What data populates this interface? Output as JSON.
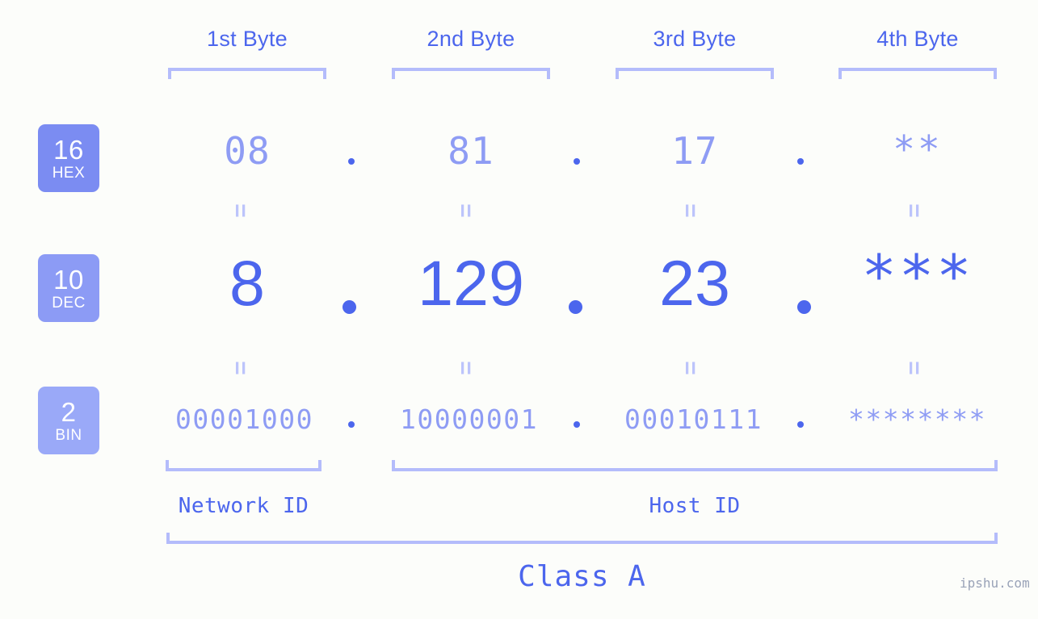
{
  "page": {
    "background_color": "#fcfdfa",
    "accent_color": "#4c66ed",
    "muted_color": "#8e9cf4",
    "bracket_color": "#b4bcfb"
  },
  "byte_headers": [
    {
      "label": "1st Byte"
    },
    {
      "label": "2nd Byte"
    },
    {
      "label": "3rd Byte"
    },
    {
      "label": "4th Byte"
    }
  ],
  "bases": [
    {
      "number": "16",
      "name": "HEX",
      "color": "#7b8cf2"
    },
    {
      "number": "10",
      "name": "DEC",
      "color": "#8c9bf5"
    },
    {
      "number": "2",
      "name": "BIN",
      "color": "#9aa9f8"
    }
  ],
  "rows": {
    "hex": {
      "base_number": "16",
      "base_name": "HEX",
      "values": [
        "08",
        "81",
        "17",
        "**"
      ],
      "separator": "."
    },
    "dec": {
      "base_number": "10",
      "base_name": "DEC",
      "values": [
        "8",
        "129",
        "23",
        "***"
      ],
      "separator": "."
    },
    "bin": {
      "base_number": "2",
      "base_name": "BIN",
      "values": [
        "00001000",
        "10000001",
        "00010111",
        "********"
      ],
      "separator": "."
    }
  },
  "equals_sign": "=",
  "sections": {
    "network_id": "Network ID",
    "host_id": "Host ID",
    "class": "Class A"
  },
  "watermark": "ipshu.com"
}
